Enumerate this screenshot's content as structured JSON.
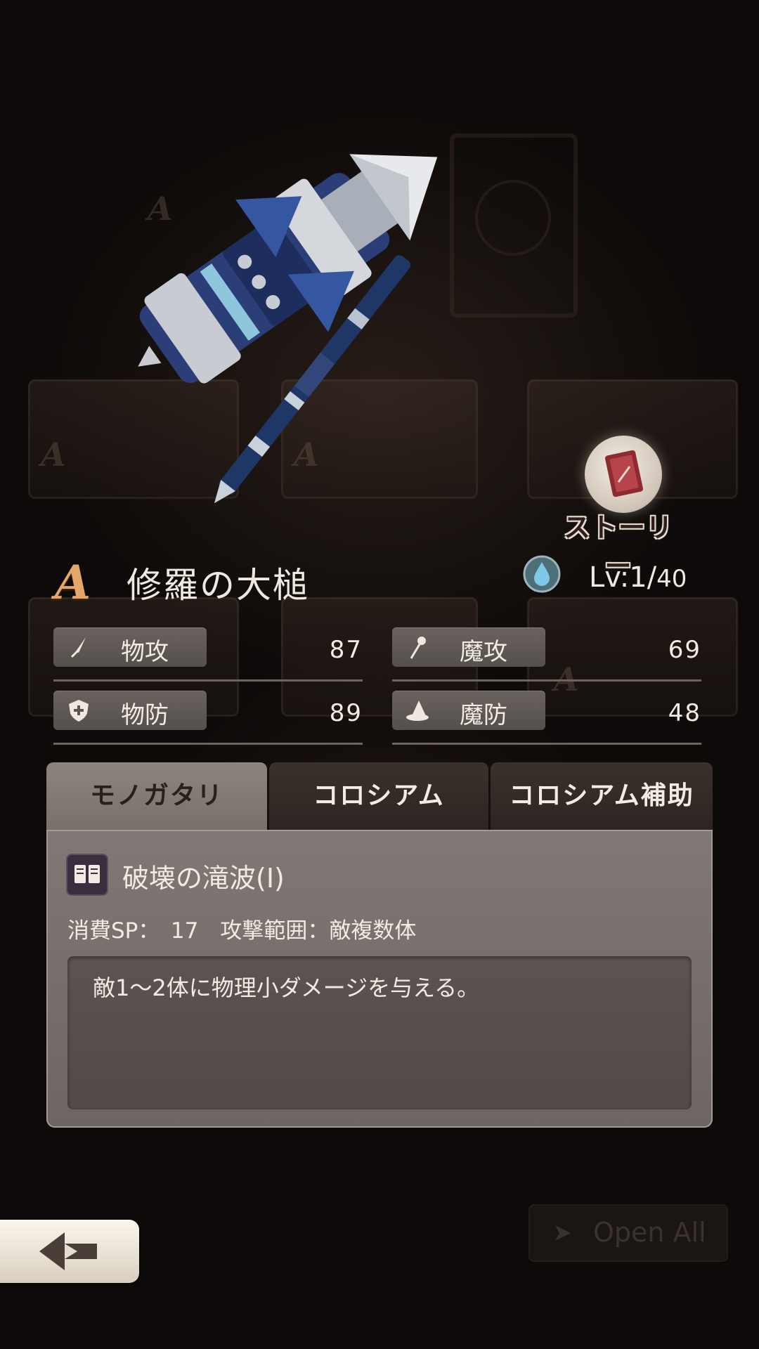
{
  "story": {
    "label": "ストーリー"
  },
  "weapon": {
    "rank": "A",
    "name": "修羅の大槌",
    "element_icon": "water-drop-icon",
    "level_prefix": "Lv:1/",
    "level_max": "40"
  },
  "stats": [
    {
      "icon": "sword-icon",
      "label": "物攻",
      "value": "87"
    },
    {
      "icon": "staff-icon",
      "label": "魔攻",
      "value": "69"
    },
    {
      "icon": "shield-icon",
      "label": "物防",
      "value": "89"
    },
    {
      "icon": "hat-icon",
      "label": "魔防",
      "value": "48"
    }
  ],
  "tabs": [
    {
      "label": "モノガタリ",
      "active": true
    },
    {
      "label": "コロシアム",
      "active": false
    },
    {
      "label": "コロシアム補助",
      "active": false
    }
  ],
  "skill": {
    "icon": "book-icon",
    "name": "破壊の滝波(Ⅰ)",
    "meta": "消費SP：　17　攻撃範囲：敵複数体",
    "description": "敵1～2体に物理小ダメージを与える。"
  },
  "controls": {
    "back_icon": "back-arrow-icon",
    "open_all_label": "Open All",
    "open_all_icon": "arrow-right-icon"
  },
  "colors": {
    "rank_gold": "#e1a869",
    "hammer_blue": "#2f4f8f",
    "panel_bg": "#817875"
  }
}
